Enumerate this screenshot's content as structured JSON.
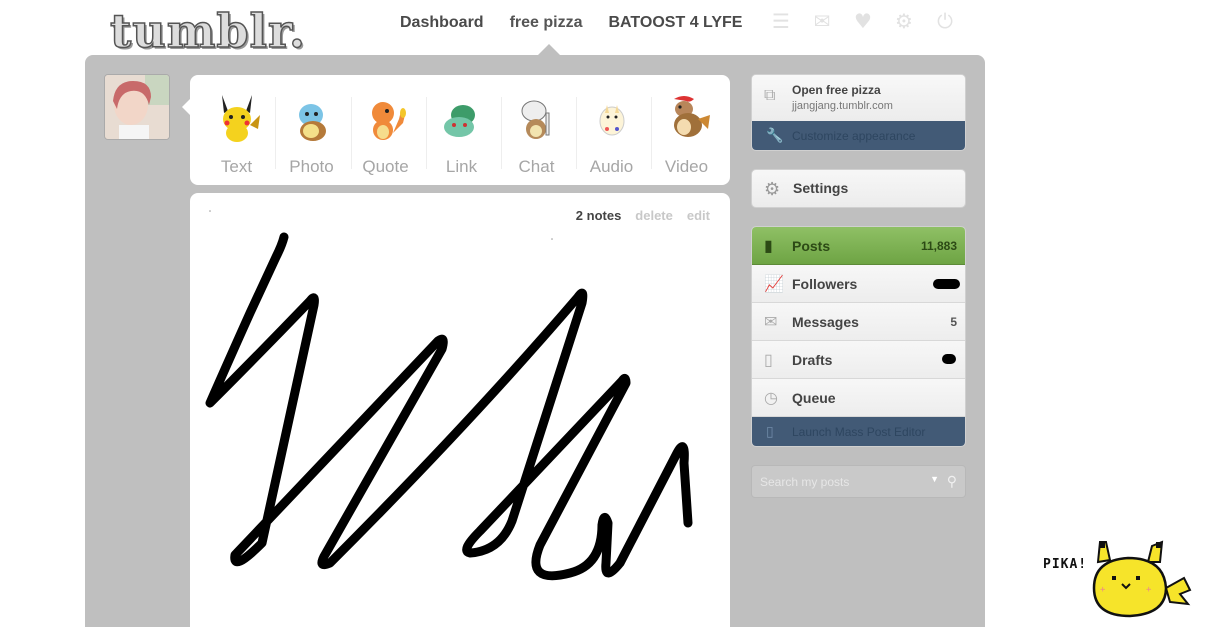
{
  "header": {
    "logo_text": "tumblr.",
    "nav": [
      "Dashboard",
      "free pizza",
      "BATOOST 4 LYFE"
    ],
    "icons": [
      "list-icon",
      "mail-icon",
      "heart-icon",
      "gear-icon",
      "power-icon"
    ]
  },
  "post_types": [
    {
      "label": "Text",
      "sprite": "pikachu"
    },
    {
      "label": "Photo",
      "sprite": "squirtle"
    },
    {
      "label": "Quote",
      "sprite": "charmander"
    },
    {
      "label": "Link",
      "sprite": "bulbasaur"
    },
    {
      "label": "Chat",
      "sprite": "cubone"
    },
    {
      "label": "Audio",
      "sprite": "togepi"
    },
    {
      "label": "Video",
      "sprite": "pidgeotto"
    }
  ],
  "post": {
    "notes": "2 notes",
    "delete": "delete",
    "edit": "edit"
  },
  "sidebar": {
    "blog_title": "Open free pizza",
    "blog_url": "jjangjang.tumblr.com",
    "customize": "Customize appearance",
    "settings": "Settings",
    "stats": [
      {
        "label": "Posts",
        "count": "11,883",
        "icon": "document-icon"
      },
      {
        "label": "Followers",
        "count": "",
        "icon": "chart-icon"
      },
      {
        "label": "Messages",
        "count": "5",
        "icon": "envelope-icon"
      },
      {
        "label": "Drafts",
        "count": "",
        "icon": "draft-icon"
      },
      {
        "label": "Queue",
        "count": "",
        "icon": "clock-icon"
      }
    ],
    "mass_editor": "Launch Mass Post Editor",
    "search_placeholder": "Search my posts"
  },
  "corner": {
    "pika_text": "PIKA!"
  },
  "colors": {
    "panel": "#bfbfbf",
    "posts_green": "#7ab04f",
    "dark_blue": "#425a76"
  }
}
